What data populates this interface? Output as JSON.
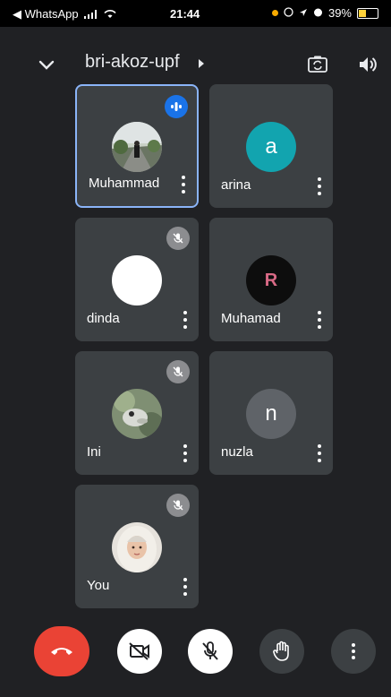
{
  "status_bar": {
    "back_app": "◀ WhatsApp",
    "time": "21:44",
    "battery": "39%"
  },
  "meeting": {
    "code": "bri-akoz-upf"
  },
  "participants": [
    {
      "name": "Muhammad",
      "avatar_type": "photo-person-road",
      "state": "speaking",
      "active": true
    },
    {
      "name": "arina",
      "avatar_letter": "a",
      "avatar_color": "#12a4af",
      "state": "unmuted"
    },
    {
      "name": "dinda",
      "avatar_type": "blank-white",
      "state": "muted"
    },
    {
      "name": "Muhamad",
      "avatar_type": "letter-r-dark",
      "avatar_letter": "R",
      "state": "unmuted"
    },
    {
      "name": "Ini",
      "avatar_type": "photo-animal",
      "state": "muted"
    },
    {
      "name": "nuzla",
      "avatar_letter": "n",
      "avatar_color": "#5f6368",
      "state": "unmuted"
    },
    {
      "name": "You",
      "avatar_type": "photo-hijab",
      "state": "muted"
    }
  ],
  "controls": [
    "end-call",
    "camera-off",
    "mic-off",
    "raise-hand",
    "more-options"
  ],
  "colors": {
    "background": "#202124",
    "tile": "#3c4043",
    "active_border": "#8ab4f8",
    "end_call": "#ea4335",
    "speaking": "#1a73e8"
  }
}
